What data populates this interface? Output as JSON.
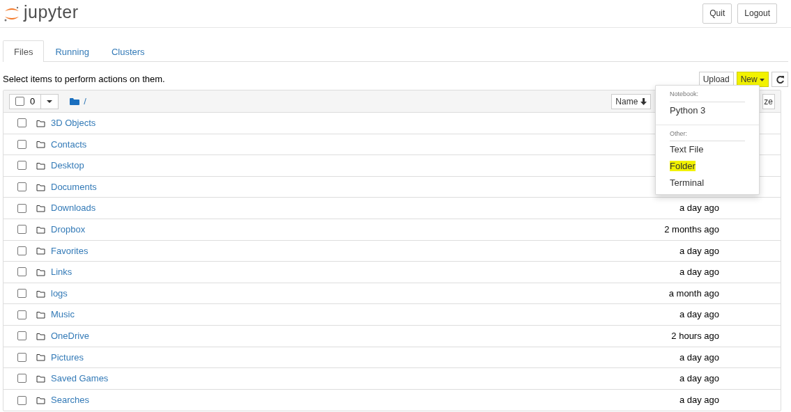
{
  "header": {
    "logo_text": "jupyter",
    "buttons": [
      "Quit",
      "Logout"
    ]
  },
  "tabs": [
    {
      "label": "Files",
      "selected": true
    },
    {
      "label": "Running",
      "selected": false
    },
    {
      "label": "Clusters",
      "selected": false
    }
  ],
  "hint": "Select items to perform actions on them.",
  "toolbar": {
    "upload": "Upload",
    "new": {
      "label": "New",
      "highlighted": true
    }
  },
  "list_header": {
    "count": "0",
    "checked": false,
    "path": "/",
    "sort_button": "Name",
    "column_3": "ze"
  },
  "rows": [
    {
      "name": "3D Objects",
      "checked": false
    },
    {
      "name": "Contacts",
      "checked": false
    },
    {
      "name": "Desktop",
      "checked": false
    },
    {
      "name": "Documents",
      "checked": false
    },
    {
      "name": "Downloads",
      "checked": false,
      "modified": "a day ago"
    },
    {
      "name": "Dropbox",
      "checked": false,
      "modified": "2 months ago"
    },
    {
      "name": "Favorites",
      "checked": false,
      "modified": "a day ago"
    },
    {
      "name": "Links",
      "checked": false,
      "modified": "a day ago"
    },
    {
      "name": "logs",
      "checked": false,
      "modified": "a month ago"
    },
    {
      "name": "Music",
      "checked": false,
      "modified": "a day ago"
    },
    {
      "name": "OneDrive",
      "checked": false,
      "modified": "2 hours ago"
    },
    {
      "name": "Pictures",
      "checked": false,
      "modified": "a day ago"
    },
    {
      "name": "Saved Games",
      "checked": false,
      "modified": "a day ago"
    },
    {
      "name": "Searches",
      "checked": false,
      "modified": "a day ago"
    }
  ],
  "new_menu": [
    {
      "kind": "header",
      "label": "Notebook:"
    },
    {
      "kind": "item",
      "label": "Python 3",
      "highlighted": false
    },
    {
      "kind": "divider"
    },
    {
      "kind": "header",
      "label": "Other:"
    },
    {
      "kind": "item",
      "label": "Text File",
      "highlighted": false
    },
    {
      "kind": "item",
      "label": "Folder",
      "highlighted": true
    },
    {
      "kind": "item",
      "label": "Terminal",
      "highlighted": false
    }
  ]
}
